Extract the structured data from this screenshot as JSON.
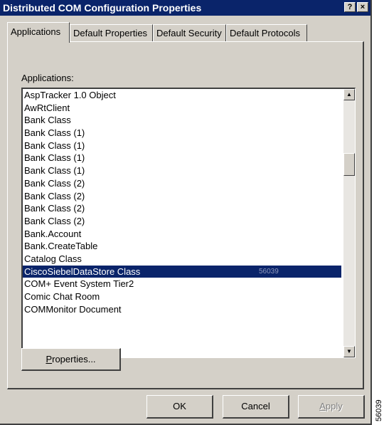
{
  "window": {
    "title": "Distributed COM Configuration Properties",
    "help_glyph": "?",
    "close_glyph": "×"
  },
  "tabs": [
    {
      "label": "Applications",
      "active": true
    },
    {
      "label": "Default Properties",
      "active": false
    },
    {
      "label": "Default Security",
      "active": false
    },
    {
      "label": "Default Protocols",
      "active": false
    }
  ],
  "applications": {
    "label": "Applications:",
    "items": [
      "AspTracker 1.0 Object",
      "AwRtClient",
      "Bank Class",
      "Bank Class (1)",
      "Bank Class (1)",
      "Bank Class (1)",
      "Bank Class (1)",
      "Bank Class (2)",
      "Bank Class (2)",
      "Bank Class (2)",
      "Bank Class (2)",
      "Bank.Account",
      "Bank.CreateTable",
      "Catalog Class",
      "CiscoSiebelDataStore Class",
      "COM+ Event System Tier2",
      "Comic Chat Room",
      "COMMonitor Document"
    ],
    "selected_index": 14,
    "selected_mark": "56039",
    "scroll_up_glyph": "▲",
    "scroll_down_glyph": "▼"
  },
  "buttons": {
    "properties": {
      "mnemonic": "P",
      "rest": "roperties..."
    },
    "ok": "OK",
    "cancel": "Cancel",
    "apply": {
      "mnemonic": "A",
      "rest": "pply"
    }
  },
  "figure_number": "56039"
}
